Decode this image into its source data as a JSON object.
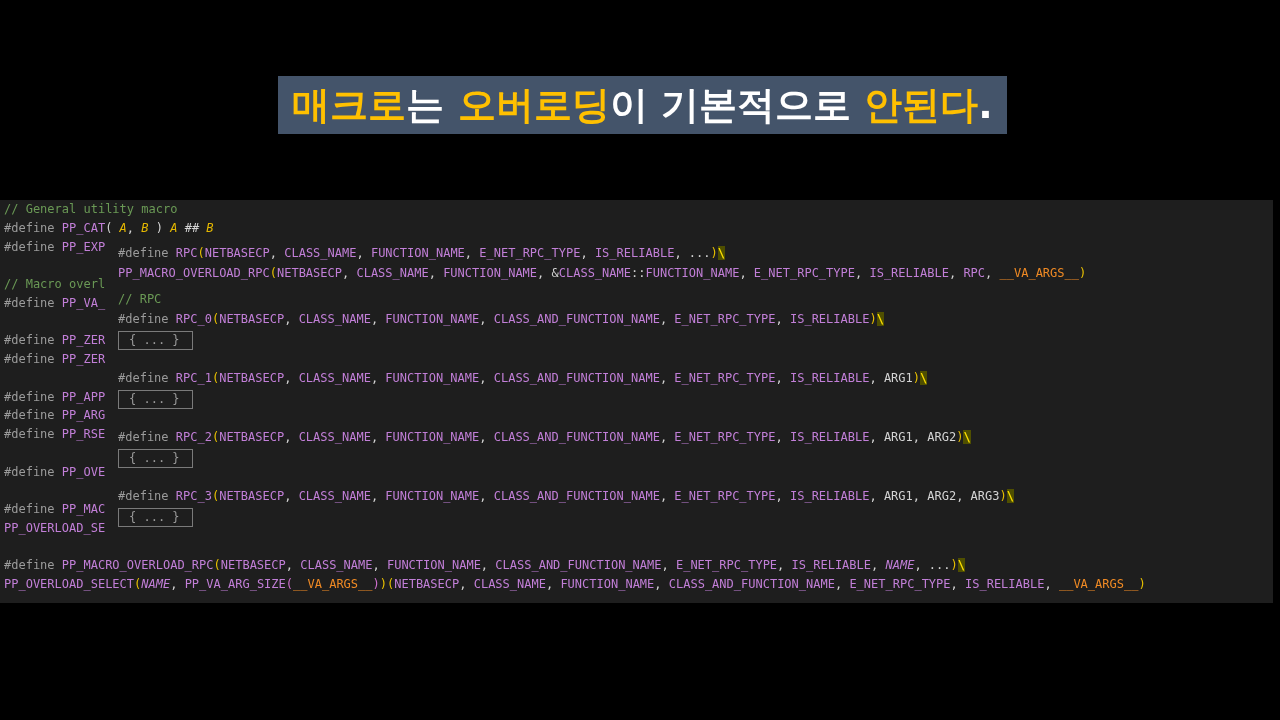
{
  "title": {
    "segments": [
      {
        "text": "매크로",
        "highlight": true
      },
      {
        "text": "는 ",
        "highlight": false
      },
      {
        "text": "오버로딩",
        "highlight": true
      },
      {
        "text": "이 기본적으로 ",
        "highlight": false
      },
      {
        "text": "안된다",
        "highlight": true
      },
      {
        "text": ".",
        "highlight": false
      }
    ]
  },
  "editor": {
    "lines": [
      {
        "kind": "code",
        "tokens": [
          {
            "kind": "comment",
            "text": "// General utility macro"
          }
        ]
      },
      {
        "kind": "code",
        "tokens": [
          {
            "kind": "directive",
            "text": "#define "
          },
          {
            "kind": "macro",
            "text": "PP_CAT"
          },
          {
            "kind": "plain",
            "text": "( "
          },
          {
            "kind": "param",
            "text": "A"
          },
          {
            "kind": "plain",
            "text": ", "
          },
          {
            "kind": "param",
            "text": "B"
          },
          {
            "kind": "plain",
            "text": " ) "
          },
          {
            "kind": "param",
            "text": "A"
          },
          {
            "kind": "plain",
            "text": " ## "
          },
          {
            "kind": "param",
            "text": "B"
          }
        ]
      },
      {
        "kind": "code",
        "tokens": [
          {
            "kind": "directive",
            "text": "#define "
          },
          {
            "kind": "macro",
            "text": "PP_EXP"
          }
        ]
      },
      {
        "kind": "blank"
      },
      {
        "kind": "code",
        "tokens": [
          {
            "kind": "comment",
            "text": "// Macro overl"
          }
        ]
      },
      {
        "kind": "code",
        "tokens": [
          {
            "kind": "directive",
            "text": "#define "
          },
          {
            "kind": "macro",
            "text": "PP_VA_"
          }
        ]
      },
      {
        "kind": "blank"
      },
      {
        "kind": "code",
        "tokens": [
          {
            "kind": "directive",
            "text": "#define "
          },
          {
            "kind": "macro",
            "text": "PP_ZER"
          }
        ]
      },
      {
        "kind": "code",
        "tokens": [
          {
            "kind": "directive",
            "text": "#define "
          },
          {
            "kind": "macro",
            "text": "PP_ZER"
          }
        ]
      },
      {
        "kind": "blank"
      },
      {
        "kind": "code",
        "tokens": [
          {
            "kind": "directive",
            "text": "#define "
          },
          {
            "kind": "macro",
            "text": "PP_APP"
          }
        ]
      },
      {
        "kind": "code",
        "tokens": [
          {
            "kind": "directive",
            "text": "#define "
          },
          {
            "kind": "macro",
            "text": "PP_ARG"
          }
        ]
      },
      {
        "kind": "code",
        "tokens": [
          {
            "kind": "directive",
            "text": "#define "
          },
          {
            "kind": "macro",
            "text": "PP_RSE"
          }
        ]
      },
      {
        "kind": "blank"
      },
      {
        "kind": "code",
        "tokens": [
          {
            "kind": "directive",
            "text": "#define "
          },
          {
            "kind": "macro",
            "text": "PP_OVE"
          }
        ]
      },
      {
        "kind": "blank"
      },
      {
        "kind": "code",
        "tokens": [
          {
            "kind": "directive",
            "text": "#define "
          },
          {
            "kind": "macro",
            "text": "PP_MAC"
          }
        ]
      },
      {
        "kind": "code",
        "tokens": [
          {
            "kind": "macro",
            "text": "PP_OVERLOAD_SE"
          }
        ]
      },
      {
        "kind": "blank"
      },
      {
        "kind": "code",
        "tokens": [
          {
            "kind": "directive",
            "text": "#define "
          },
          {
            "kind": "macro",
            "text": "PP_MACRO_OVERLOAD_RPC"
          },
          {
            "kind": "bracket",
            "text": "("
          },
          {
            "kind": "macro",
            "text": "NETBASECP"
          },
          {
            "kind": "plain",
            "text": ", "
          },
          {
            "kind": "macro",
            "text": "CLASS_NAME"
          },
          {
            "kind": "plain",
            "text": ", "
          },
          {
            "kind": "macro",
            "text": "FUNCTION_NAME"
          },
          {
            "kind": "plain",
            "text": ", "
          },
          {
            "kind": "macro",
            "text": "CLASS_AND_FUNCTION_NAME"
          },
          {
            "kind": "plain",
            "text": ", "
          },
          {
            "kind": "macro",
            "text": "E_NET_RPC_TYPE"
          },
          {
            "kind": "plain",
            "text": ", "
          },
          {
            "kind": "macro",
            "text": "IS_RELIABLE"
          },
          {
            "kind": "plain",
            "text": ", "
          },
          {
            "kind": "macro_italic",
            "text": "NAME"
          },
          {
            "kind": "plain",
            "text": ", ..."
          },
          {
            "kind": "bracket",
            "text": ")"
          },
          {
            "kind": "escape",
            "text": "\\"
          }
        ]
      },
      {
        "kind": "code",
        "tokens": [
          {
            "kind": "macro",
            "text": "PP_OVERLOAD_SELECT"
          },
          {
            "kind": "bracket",
            "text": "("
          },
          {
            "kind": "macro_italic",
            "text": "NAME"
          },
          {
            "kind": "plain",
            "text": ", "
          },
          {
            "kind": "macro",
            "text": "PP_VA_ARG_SIZE"
          },
          {
            "kind": "bracket2",
            "text": "("
          },
          {
            "kind": "va",
            "text": "__VA_ARGS__"
          },
          {
            "kind": "bracket2",
            "text": ")"
          },
          {
            "kind": "bracket",
            "text": ")("
          },
          {
            "kind": "macro",
            "text": "NETBASECP"
          },
          {
            "kind": "plain",
            "text": ", "
          },
          {
            "kind": "macro",
            "text": "CLASS_NAME"
          },
          {
            "kind": "plain",
            "text": ", "
          },
          {
            "kind": "macro",
            "text": "FUNCTION_NAME"
          },
          {
            "kind": "plain",
            "text": ", "
          },
          {
            "kind": "macro",
            "text": "CLASS_AND_FUNCTION_NAME"
          },
          {
            "kind": "plain",
            "text": ", "
          },
          {
            "kind": "macro",
            "text": "E_NET_RPC_TYPE"
          },
          {
            "kind": "plain",
            "text": ", "
          },
          {
            "kind": "macro",
            "text": "IS_RELIABLE"
          },
          {
            "kind": "plain",
            "text": ", "
          },
          {
            "kind": "va",
            "text": "__VA_ARGS__"
          },
          {
            "kind": "bracket",
            "text": ")"
          }
        ]
      }
    ]
  },
  "hover_panel": {
    "sections": [
      {
        "lines": [
          {
            "kind": "code",
            "tokens": [
              {
                "kind": "directive",
                "text": "#define "
              },
              {
                "kind": "macro",
                "text": "RPC"
              },
              {
                "kind": "bracket",
                "text": "("
              },
              {
                "kind": "macro",
                "text": "NETBASECP"
              },
              {
                "kind": "plain",
                "text": ", "
              },
              {
                "kind": "macro",
                "text": "CLASS_NAME"
              },
              {
                "kind": "plain",
                "text": ", "
              },
              {
                "kind": "macro",
                "text": "FUNCTION_NAME"
              },
              {
                "kind": "plain",
                "text": ", "
              },
              {
                "kind": "macro",
                "text": "E_NET_RPC_TYPE"
              },
              {
                "kind": "plain",
                "text": ", "
              },
              {
                "kind": "macro",
                "text": "IS_RELIABLE"
              },
              {
                "kind": "plain",
                "text": ", ..."
              },
              {
                "kind": "bracket",
                "text": ")"
              },
              {
                "kind": "escape",
                "text": "\\"
              }
            ]
          },
          {
            "kind": "code",
            "tokens": [
              {
                "kind": "macro",
                "text": "PP_MACRO_OVERLOAD_RPC"
              },
              {
                "kind": "bracket",
                "text": "("
              },
              {
                "kind": "macro",
                "text": "NETBASECP"
              },
              {
                "kind": "plain",
                "text": ", "
              },
              {
                "kind": "macro",
                "text": "CLASS_NAME"
              },
              {
                "kind": "plain",
                "text": ", "
              },
              {
                "kind": "macro",
                "text": "FUNCTION_NAME"
              },
              {
                "kind": "plain",
                "text": ", &"
              },
              {
                "kind": "macro",
                "text": "CLASS_NAME"
              },
              {
                "kind": "plain",
                "text": "::"
              },
              {
                "kind": "macro",
                "text": "FUNCTION_NAME"
              },
              {
                "kind": "plain",
                "text": ", "
              },
              {
                "kind": "macro",
                "text": "E_NET_RPC_TYPE"
              },
              {
                "kind": "plain",
                "text": ", "
              },
              {
                "kind": "macro",
                "text": "IS_RELIABLE"
              },
              {
                "kind": "plain",
                "text": ", "
              },
              {
                "kind": "macro",
                "text": "RPC"
              },
              {
                "kind": "plain",
                "text": ", "
              },
              {
                "kind": "va",
                "text": "__VA_ARGS__"
              },
              {
                "kind": "bracket",
                "text": ")"
              }
            ]
          }
        ]
      },
      {
        "lines": [
          {
            "kind": "code",
            "tokens": [
              {
                "kind": "comment",
                "text": "// RPC"
              }
            ]
          },
          {
            "kind": "code",
            "tokens": [
              {
                "kind": "directive",
                "text": "#define "
              },
              {
                "kind": "macro",
                "text": "RPC_0"
              },
              {
                "kind": "bracket",
                "text": "("
              },
              {
                "kind": "macro",
                "text": "NETBASECP"
              },
              {
                "kind": "plain",
                "text": ", "
              },
              {
                "kind": "macro",
                "text": "CLASS_NAME"
              },
              {
                "kind": "plain",
                "text": ", "
              },
              {
                "kind": "macro",
                "text": "FUNCTION_NAME"
              },
              {
                "kind": "plain",
                "text": ", "
              },
              {
                "kind": "macro",
                "text": "CLASS_AND_FUNCTION_NAME"
              },
              {
                "kind": "plain",
                "text": ", "
              },
              {
                "kind": "macro",
                "text": "E_NET_RPC_TYPE"
              },
              {
                "kind": "plain",
                "text": ", "
              },
              {
                "kind": "macro",
                "text": "IS_RELIABLE"
              },
              {
                "kind": "bracket",
                "text": ")"
              },
              {
                "kind": "escape",
                "text": "\\"
              }
            ]
          },
          {
            "kind": "fold",
            "text": "{ ... }"
          }
        ]
      },
      {
        "lines": [
          {
            "kind": "code",
            "tokens": [
              {
                "kind": "directive",
                "text": "#define "
              },
              {
                "kind": "macro",
                "text": "RPC_1"
              },
              {
                "kind": "bracket",
                "text": "("
              },
              {
                "kind": "macro",
                "text": "NETBASECP"
              },
              {
                "kind": "plain",
                "text": ", "
              },
              {
                "kind": "macro",
                "text": "CLASS_NAME"
              },
              {
                "kind": "plain",
                "text": ", "
              },
              {
                "kind": "macro",
                "text": "FUNCTION_NAME"
              },
              {
                "kind": "plain",
                "text": ", "
              },
              {
                "kind": "macro",
                "text": "CLASS_AND_FUNCTION_NAME"
              },
              {
                "kind": "plain",
                "text": ", "
              },
              {
                "kind": "macro",
                "text": "E_NET_RPC_TYPE"
              },
              {
                "kind": "plain",
                "text": ", "
              },
              {
                "kind": "macro",
                "text": "IS_RELIABLE"
              },
              {
                "kind": "plain",
                "text": ", ARG1"
              },
              {
                "kind": "bracket",
                "text": ")"
              },
              {
                "kind": "escape",
                "text": "\\"
              }
            ]
          },
          {
            "kind": "fold",
            "text": "{ ... }"
          }
        ]
      },
      {
        "lines": [
          {
            "kind": "code",
            "tokens": [
              {
                "kind": "directive",
                "text": "#define "
              },
              {
                "kind": "macro",
                "text": "RPC_2"
              },
              {
                "kind": "bracket",
                "text": "("
              },
              {
                "kind": "macro",
                "text": "NETBASECP"
              },
              {
                "kind": "plain",
                "text": ", "
              },
              {
                "kind": "macro",
                "text": "CLASS_NAME"
              },
              {
                "kind": "plain",
                "text": ", "
              },
              {
                "kind": "macro",
                "text": "FUNCTION_NAME"
              },
              {
                "kind": "plain",
                "text": ", "
              },
              {
                "kind": "macro",
                "text": "CLASS_AND_FUNCTION_NAME"
              },
              {
                "kind": "plain",
                "text": ", "
              },
              {
                "kind": "macro",
                "text": "E_NET_RPC_TYPE"
              },
              {
                "kind": "plain",
                "text": ", "
              },
              {
                "kind": "macro",
                "text": "IS_RELIABLE"
              },
              {
                "kind": "plain",
                "text": ", ARG1, ARG2"
              },
              {
                "kind": "bracket",
                "text": ")"
              },
              {
                "kind": "escape",
                "text": "\\"
              }
            ]
          },
          {
            "kind": "fold",
            "text": "{ ... }"
          }
        ]
      },
      {
        "lines": [
          {
            "kind": "code",
            "tokens": [
              {
                "kind": "directive",
                "text": "#define "
              },
              {
                "kind": "macro",
                "text": "RPC_3"
              },
              {
                "kind": "bracket",
                "text": "("
              },
              {
                "kind": "macro",
                "text": "NETBASECP"
              },
              {
                "kind": "plain",
                "text": ", "
              },
              {
                "kind": "macro",
                "text": "CLASS_NAME"
              },
              {
                "kind": "plain",
                "text": ", "
              },
              {
                "kind": "macro",
                "text": "FUNCTION_NAME"
              },
              {
                "kind": "plain",
                "text": ", "
              },
              {
                "kind": "macro",
                "text": "CLASS_AND_FUNCTION_NAME"
              },
              {
                "kind": "plain",
                "text": ", "
              },
              {
                "kind": "macro",
                "text": "E_NET_RPC_TYPE"
              },
              {
                "kind": "plain",
                "text": ", "
              },
              {
                "kind": "macro",
                "text": "IS_RELIABLE"
              },
              {
                "kind": "plain",
                "text": ", ARG1, ARG2, ARG3"
              },
              {
                "kind": "bracket",
                "text": ")"
              },
              {
                "kind": "escape",
                "text": "\\"
              }
            ]
          },
          {
            "kind": "fold",
            "text": "{ ... }"
          }
        ]
      }
    ]
  }
}
